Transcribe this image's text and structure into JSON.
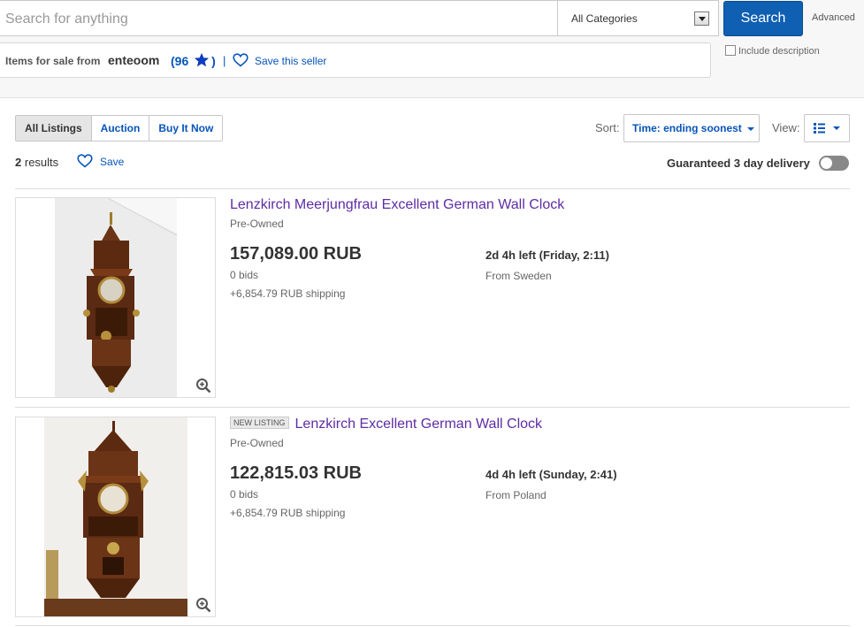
{
  "search": {
    "placeholder": "Search for anything",
    "category": "All Categories",
    "button": "Search",
    "advanced": "Advanced",
    "include_description": "Include description"
  },
  "seller": {
    "label": "Items for sale from",
    "name": "enteoom",
    "feedback_open": "(",
    "feedback": "96",
    "feedback_close": ")",
    "separator": "|",
    "save_label": "Save this seller"
  },
  "filters": {
    "tabs": [
      "All Listings",
      "Auction",
      "Buy It Now"
    ],
    "active": 0
  },
  "sort": {
    "label": "Sort:",
    "value": "Time: ending soonest"
  },
  "view": {
    "label": "View:"
  },
  "results": {
    "count": "2",
    "suffix": "results",
    "save_label": "Save"
  },
  "guaranteed": {
    "label": "Guaranteed 3 day delivery",
    "on": false
  },
  "listings": [
    {
      "badge": "",
      "title": "Lenzkirch Meerjungfrau Excellent German Wall Clock",
      "condition": "Pre-Owned",
      "price": "157,089.00 RUB",
      "bids": "0 bids",
      "shipping": "+6,854.79 RUB shipping",
      "time_left": "2d 4h left (Friday, 2:11)",
      "location": "From Sweden"
    },
    {
      "badge": "NEW LISTING",
      "title": "Lenzkirch Excellent German Wall Clock",
      "condition": "Pre-Owned",
      "price": "122,815.03 RUB",
      "bids": "0 bids",
      "shipping": "+6,854.79 RUB shipping",
      "time_left": "4d 4h left (Sunday, 2:41)",
      "location": "From Poland"
    }
  ],
  "colors": {
    "link": "#0654ba",
    "title_visited": "#5e2ca5",
    "search_button": "#0f5fb3"
  }
}
